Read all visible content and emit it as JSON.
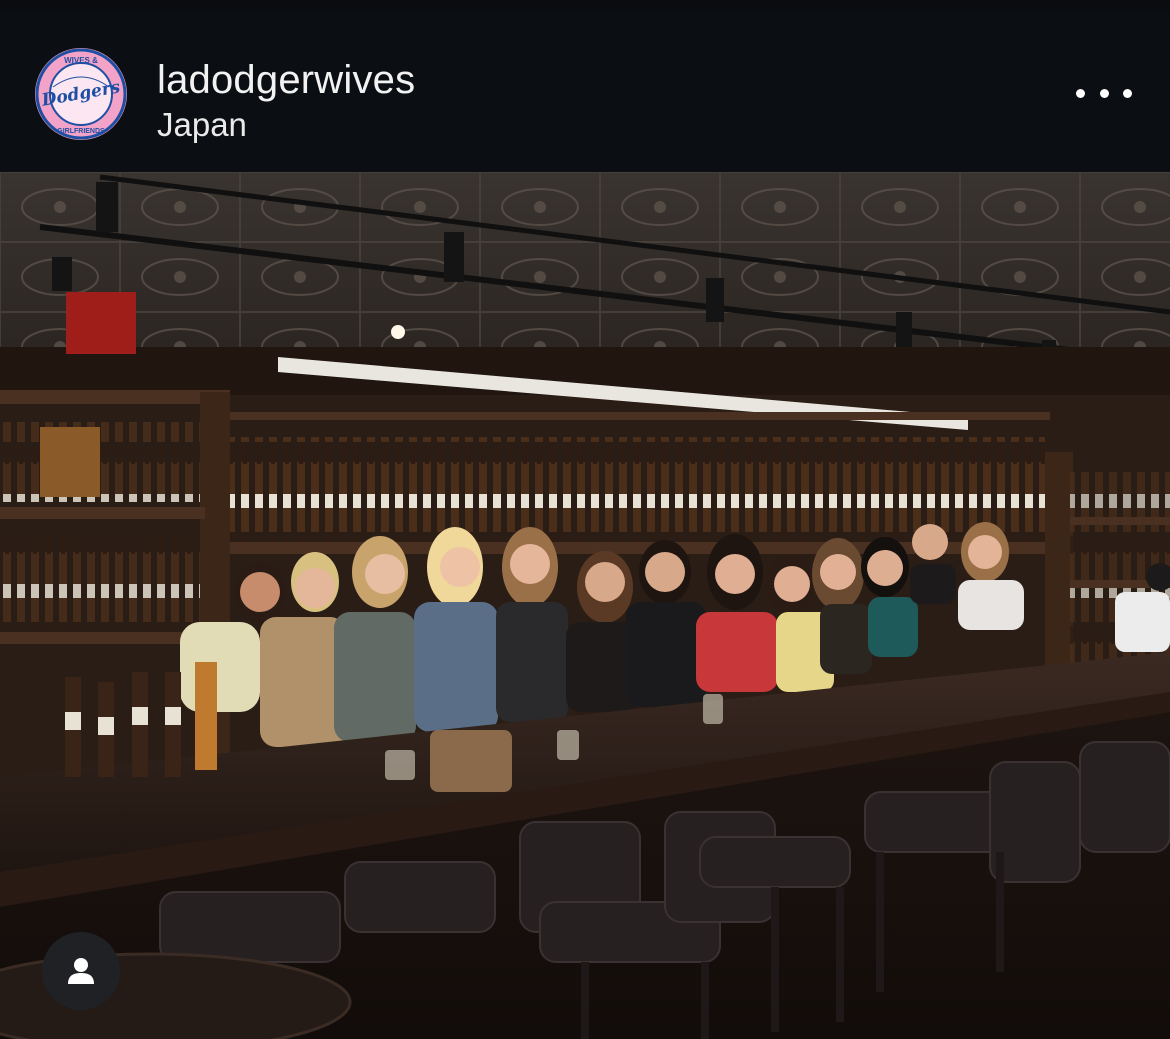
{
  "post": {
    "username": "ladodgerwives",
    "location": "Japan",
    "avatar_text_top": "WIVES &",
    "avatar_text_logo": "Dodgers",
    "avatar_text_bottom": "GIRLFRIENDS"
  },
  "icons": {
    "more": "more-horizontal-icon",
    "tagged_users": "user-icon"
  },
  "colors": {
    "header_bg": "#0b0e13",
    "text_primary": "#f2f2f2",
    "avatar_pink": "#f19ac3",
    "avatar_blue": "#1e4fa3"
  }
}
